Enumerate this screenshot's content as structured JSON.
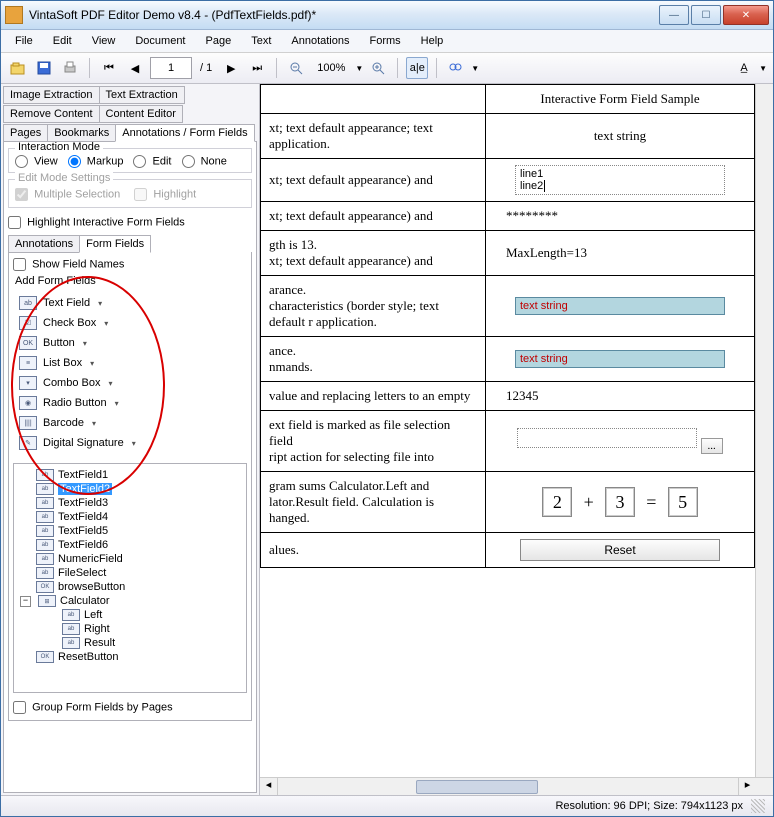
{
  "title": "VintaSoft PDF Editor Demo v8.4  -  (PdfTextFields.pdf)*",
  "menu": {
    "file": "File",
    "edit": "Edit",
    "view": "View",
    "document": "Document",
    "page": "Page",
    "text": "Text",
    "annotations": "Annotations",
    "forms": "Forms",
    "help": "Help"
  },
  "toolbar": {
    "page_current": "1",
    "page_sep": "/ 1",
    "zoom": "100%"
  },
  "side_tabs": {
    "image_extraction": "Image Extraction",
    "text_extraction": "Text Extraction",
    "remove_content": "Remove Content",
    "content_editor": "Content Editor",
    "pages": "Pages",
    "bookmarks": "Bookmarks",
    "annotations_ff": "Annotations / Form Fields"
  },
  "interaction_mode": {
    "legend": "Interaction Mode",
    "view": "View",
    "markup": "Markup",
    "edit": "Edit",
    "none": "None"
  },
  "edit_mode": {
    "legend": "Edit Mode Settings",
    "multiple_selection": "Multiple Selection",
    "highlight": "Highlight"
  },
  "highlight_iff": "Highlight Interactive Form  Fields",
  "subtabs": {
    "annotations": "Annotations",
    "form_fields": "Form Fields"
  },
  "show_field_names": "Show Field Names",
  "add_form_fields": "Add Form Fields",
  "ff_items": {
    "text_field": "Text Field",
    "check_box": "Check Box",
    "button": "Button",
    "list_box": "List Box",
    "combo_box": "Combo Box",
    "radio_button": "Radio Button",
    "barcode": "Barcode",
    "digital_signature": "Digital Signature"
  },
  "tree": {
    "tf1": "TextField1",
    "tf2": "TextField2",
    "tf3": "TextField3",
    "tf4": "TextField4",
    "tf5": "TextField5",
    "tf6": "TextField6",
    "numeric": "NumericField",
    "fileselect": "FileSelect",
    "browse": "browseButton",
    "calculator": "Calculator",
    "left": "Left",
    "right": "Right",
    "result": "Result",
    "reset": "ResetButton"
  },
  "group_by_pages": "Group Form Fields by Pages",
  "doc": {
    "header_sample": "Interactive Form Field Sample",
    "r1_desc": "xt; text default appearance; text application.",
    "r1_sample": "text string",
    "r2_desc": "xt; text default appearance) and",
    "r2_line1": "line1",
    "r2_line2": "line2",
    "r3_desc": "xt; text default appearance) and",
    "r3_sample": "********",
    "r4_desc_a": "gth is 13.",
    "r4_desc_b": "xt; text default appearance) and",
    "r4_sample": "MaxLength=13",
    "r5_desc_a": "arance.",
    "r5_desc_b": "characteristics (border style; text default r application.",
    "r5_sample": "text string",
    "r6_desc_a": "ance.",
    "r6_desc_b": "nmands.",
    "r6_sample": "text string",
    "r7_desc": "value and replacing letters to an empty",
    "r7_sample": "12345",
    "r8_desc_a": "ext field is marked as file selection field",
    "r8_desc_b": "ript action for selecting file into",
    "r8_browse": "...",
    "r9_desc_a": "gram sums Calculator.Left and",
    "r9_desc_b": "lator.Result field. Calculation is",
    "r9_desc_c": "hanged.",
    "r9_left": "2",
    "r9_plus": "+",
    "r9_right": "3",
    "r9_eq": "=",
    "r9_result": "5",
    "r10_desc": "alues.",
    "r10_reset": "Reset"
  },
  "status": "Resolution: 96 DPI; Size: 794x1123 px"
}
